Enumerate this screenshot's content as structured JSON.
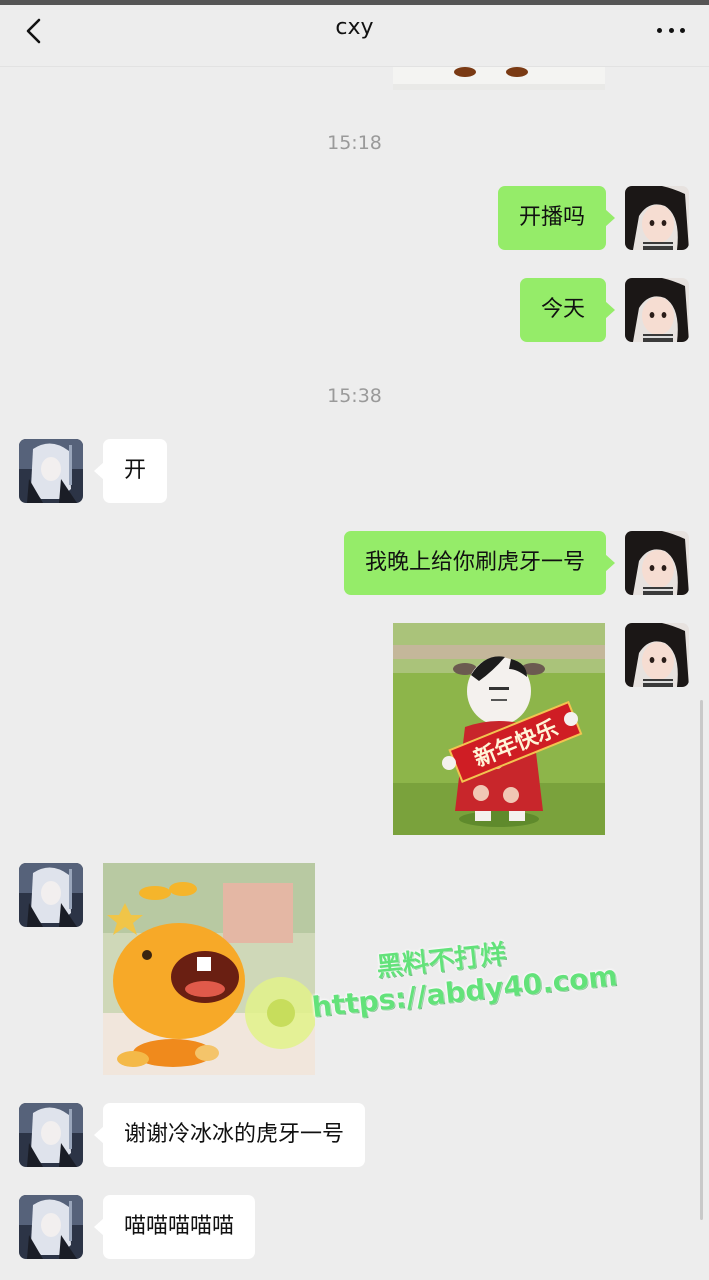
{
  "header": {
    "title": "cxy",
    "back_icon": "chevron-left-icon",
    "more_icon": "more-dots-icon"
  },
  "colors": {
    "background": "#ededed",
    "sent_bubble": "#95ec69",
    "received_bubble": "#ffffff",
    "timestamp": "#9a9a9a"
  },
  "timestamps": [
    "15:18",
    "15:38"
  ],
  "messages": [
    {
      "side": "right",
      "type": "text",
      "text": "开播吗"
    },
    {
      "side": "right",
      "type": "text",
      "text": "今天"
    },
    {
      "side": "left",
      "type": "text",
      "text": "开"
    },
    {
      "side": "right",
      "type": "text",
      "text": "我晚上给你刷虎牙一号"
    },
    {
      "side": "right",
      "type": "sticker",
      "caption": "新年快乐"
    },
    {
      "side": "left",
      "type": "sticker"
    },
    {
      "side": "left",
      "type": "text",
      "text": "谢谢冷冰冰的虎牙一号"
    },
    {
      "side": "left",
      "type": "text",
      "text": "喵喵喵喵喵"
    }
  ],
  "watermark": {
    "line1": "黑料不打烊",
    "line2": "https://abdy40.com"
  }
}
